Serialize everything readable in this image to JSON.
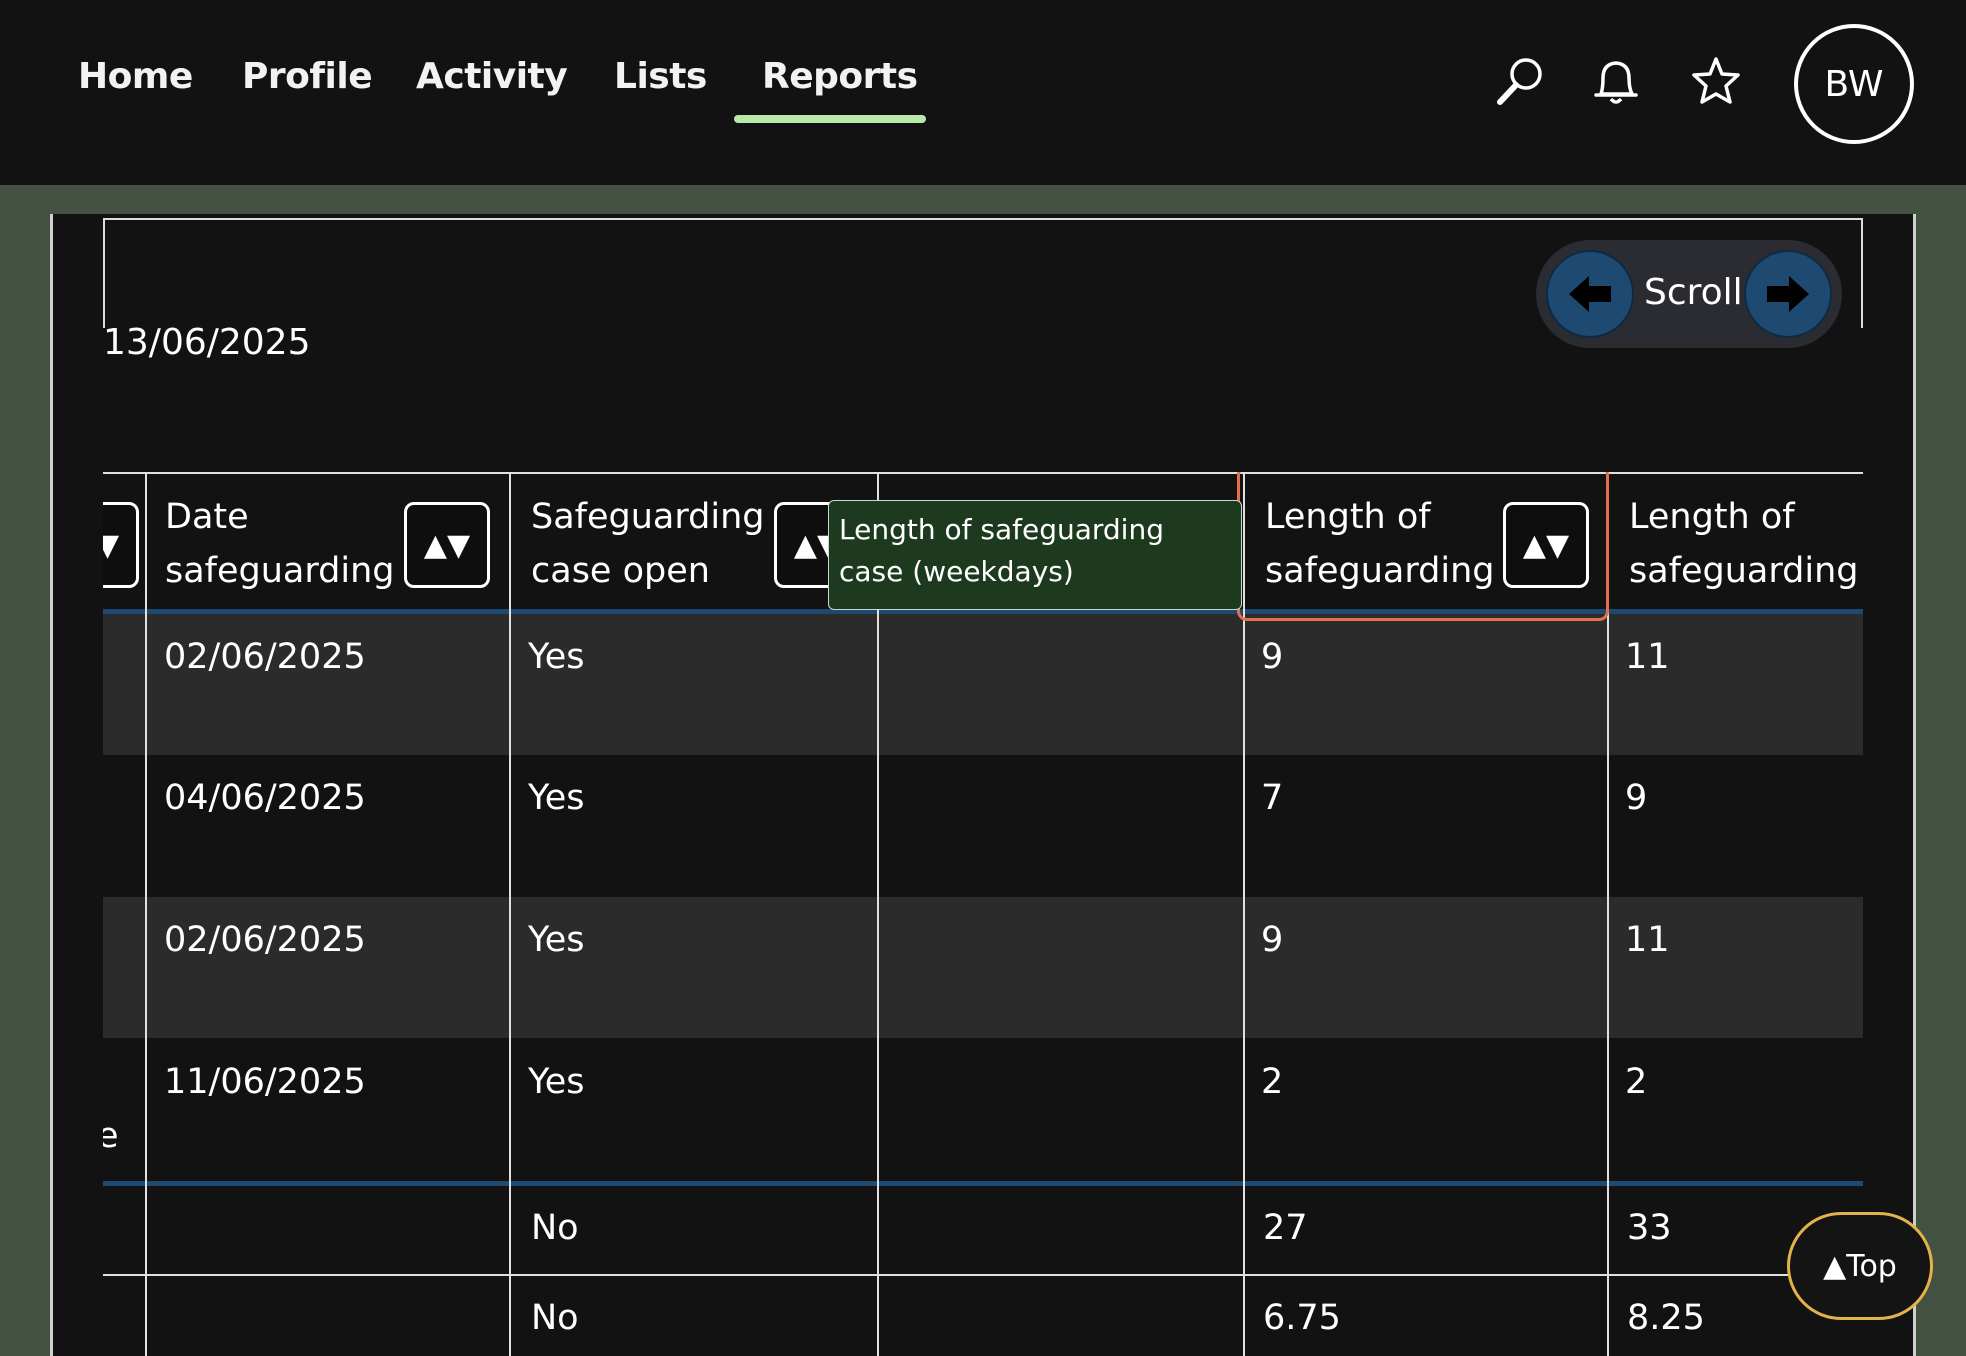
{
  "nav": {
    "items": [
      {
        "label": "Home"
      },
      {
        "label": "Profile"
      },
      {
        "label": "Activity"
      },
      {
        "label": "Lists"
      },
      {
        "label": "Reports"
      }
    ],
    "active": "Reports",
    "accent_color": "#b7eaa8"
  },
  "header": {
    "icons": [
      "search-icon",
      "bell-icon",
      "star-icon"
    ],
    "avatar_initials": "BW"
  },
  "report": {
    "date": "13/06/2025",
    "scroll": {
      "label": "Scroll",
      "left_icon": "arrow-left-icon",
      "right_icon": "arrow-right-icon"
    }
  },
  "table": {
    "columns": [
      {
        "line1": "Date",
        "line2": "safeguarding",
        "sortable": true
      },
      {
        "line1": "Safeguarding",
        "line2": "case open",
        "sortable": true
      },
      {
        "line1": "",
        "line2": "",
        "sortable": false
      },
      {
        "line1": "Length of",
        "line2": "safeguarding",
        "sortable": true
      },
      {
        "line1": "Length of",
        "line2": "safeguarding",
        "sortable": false
      }
    ],
    "sort_glyph": "▲▼",
    "rows": [
      {
        "date": "02/06/2025",
        "open": "Yes",
        "blank": "",
        "len_a": "9",
        "len_b": "11"
      },
      {
        "date": "04/06/2025",
        "open": "Yes",
        "blank": "",
        "len_a": "7",
        "len_b": "9"
      },
      {
        "date": "02/06/2025",
        "open": "Yes",
        "blank": "",
        "len_a": "9",
        "len_b": "11"
      },
      {
        "date": "11/06/2025",
        "open": "Yes",
        "blank": "",
        "len_a": "2",
        "len_b": "2"
      }
    ],
    "summary_rows": [
      {
        "open": "No",
        "len_a": "27",
        "len_b": "33"
      },
      {
        "open": "No",
        "len_a": "6.75",
        "len_b": "8.25"
      }
    ],
    "clipped_left_text": "e",
    "tooltip": "Length of safeguarding case (weekdays)"
  },
  "top_button": {
    "label": "▲Top"
  }
}
